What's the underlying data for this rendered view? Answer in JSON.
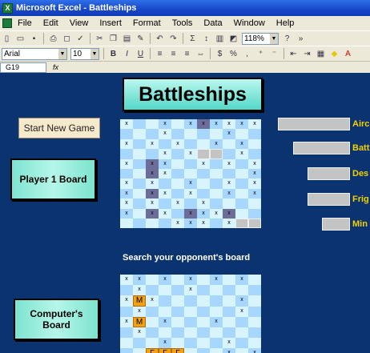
{
  "window": {
    "title": "Microsoft Excel - Battleships"
  },
  "menu": [
    "File",
    "Edit",
    "View",
    "Insert",
    "Format",
    "Tools",
    "Data",
    "Window",
    "Help"
  ],
  "toolbar": {
    "zoom": "118%",
    "font": "Arial",
    "font_size": "10"
  },
  "formula_bar": {
    "cell_ref": "G19",
    "fx": "fx"
  },
  "sheet": {
    "title": "Battleships",
    "start_button": "Start New Game",
    "player_board_label": "Player 1 Board",
    "computer_board_label": "Computer's Board",
    "search_label": "Search your opponent's board"
  },
  "fleet": [
    {
      "name": "Airc",
      "hits": 5
    },
    {
      "name": "Batt",
      "hits": 4
    },
    {
      "name": "Des",
      "hits": 3
    },
    {
      "name": "Frig",
      "hits": 3
    },
    {
      "name": "Min",
      "hits": 2
    }
  ],
  "player_board": [
    "x..x.xsxxxx",
    "...x....x..",
    "x.x.x..x.x.",
    "...x.xgg.x.",
    "x.sx..x.x.x",
    "..sx......x",
    "x.x..x..x.x",
    "x.sx.x..x.x",
    "x.x.x.x....",
    "x.sx.sxxs..",
    "....xxx.xgg"
  ],
  "computer_board": [
    "xx.x.x.x.x.",
    ".x...x.....",
    "xMx......x.",
    ".x.......x.",
    "xM.x...x...",
    ".x.........",
    "...x....x..",
    "..RRR...x.x"
  ]
}
